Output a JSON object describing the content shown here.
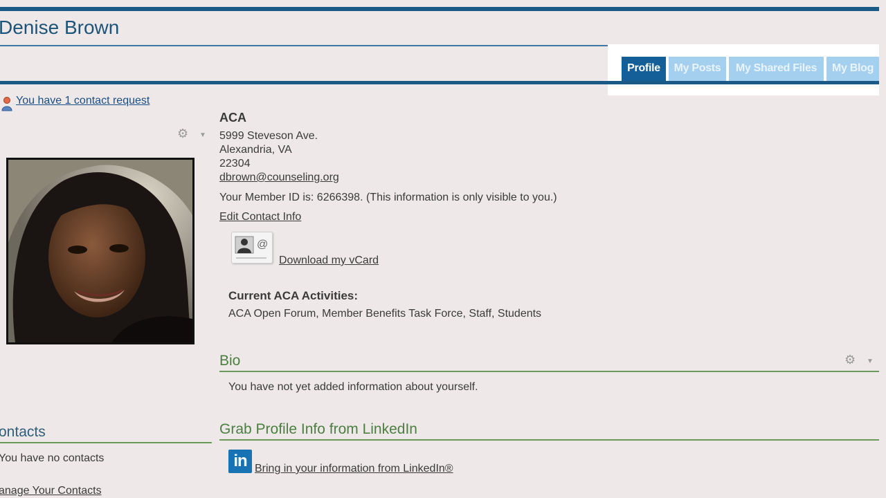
{
  "profile": {
    "name": "Denise Brown"
  },
  "tabs": [
    {
      "label": "Profile",
      "active": true
    },
    {
      "label": "My Posts",
      "active": false
    },
    {
      "label": "My Shared Files",
      "active": false
    },
    {
      "label": "My Blog",
      "active": false
    }
  ],
  "contact_request": {
    "icon": "person-icon",
    "link": "You have 1 contact request"
  },
  "contact_info": {
    "org": "ACA",
    "address1": "5999 Steveson Ave.",
    "address2": "Alexandria, VA",
    "zip": "22304",
    "email": "dbrown@counseling.org",
    "member_id_line": "Your Member ID is: 6266398. (This information is only visible to you.)",
    "edit_link": "Edit Contact Info",
    "vcard_link": "Download my vCard"
  },
  "activities": {
    "heading": "Current ACA Activities:",
    "list": "ACA Open Forum, Member Benefits Task Force, Staff, Students"
  },
  "bio": {
    "heading": "Bio",
    "text": "You have not yet added information about yourself."
  },
  "linkedin": {
    "heading": "Grab Profile Info from LinkedIn",
    "logo_text": "in",
    "link": "Bring in your information from LinkedIn®"
  },
  "contacts": {
    "heading": "ontacts",
    "empty_text": "You have no contacts",
    "manage_link": "anage Your Contacts"
  },
  "colors": {
    "brand_blue": "#1b5a87",
    "tab_active": "#155f98",
    "tab_inactive": "#a4cfee",
    "section_green": "#4a7f3f",
    "link": "#1a4e85"
  }
}
